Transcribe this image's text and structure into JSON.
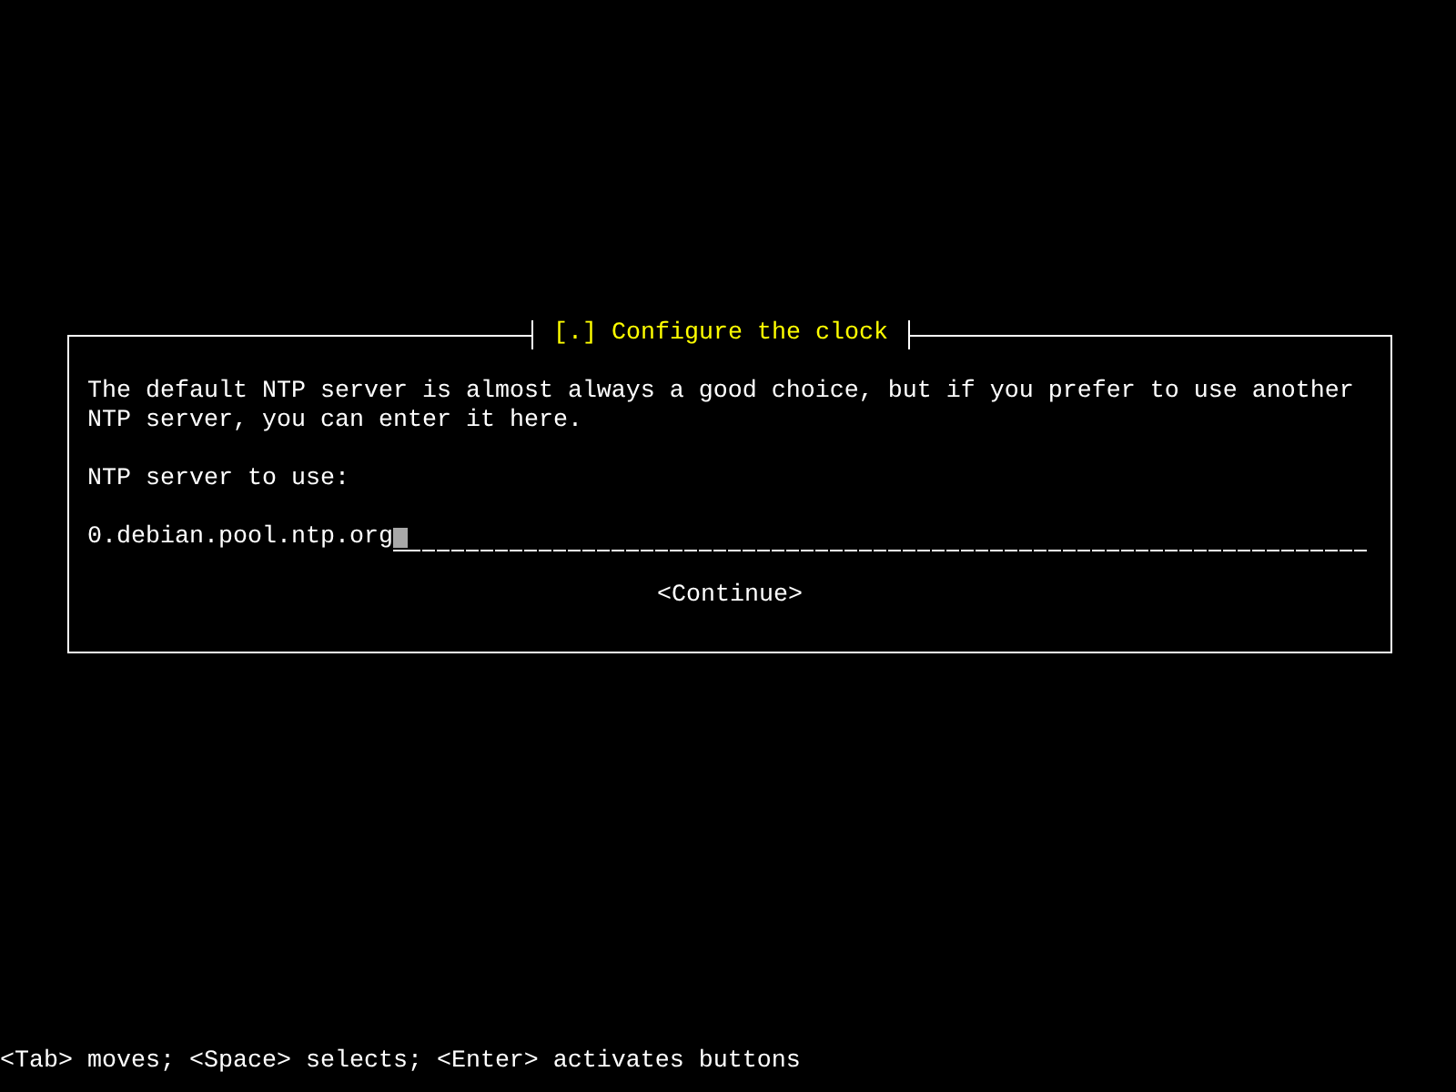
{
  "dialog": {
    "title": "[.] Configure the clock",
    "message": "The default NTP server is almost always a good choice, but if you prefer to use another NTP server, you can enter it here.",
    "field_label": "NTP server to use:",
    "input": {
      "value": "0.debian.pool.ntp.org",
      "focused": true
    },
    "buttons": [
      "<Continue>"
    ]
  },
  "status_bar": "<Tab> moves; <Space> selects; <Enter> activates buttons"
}
